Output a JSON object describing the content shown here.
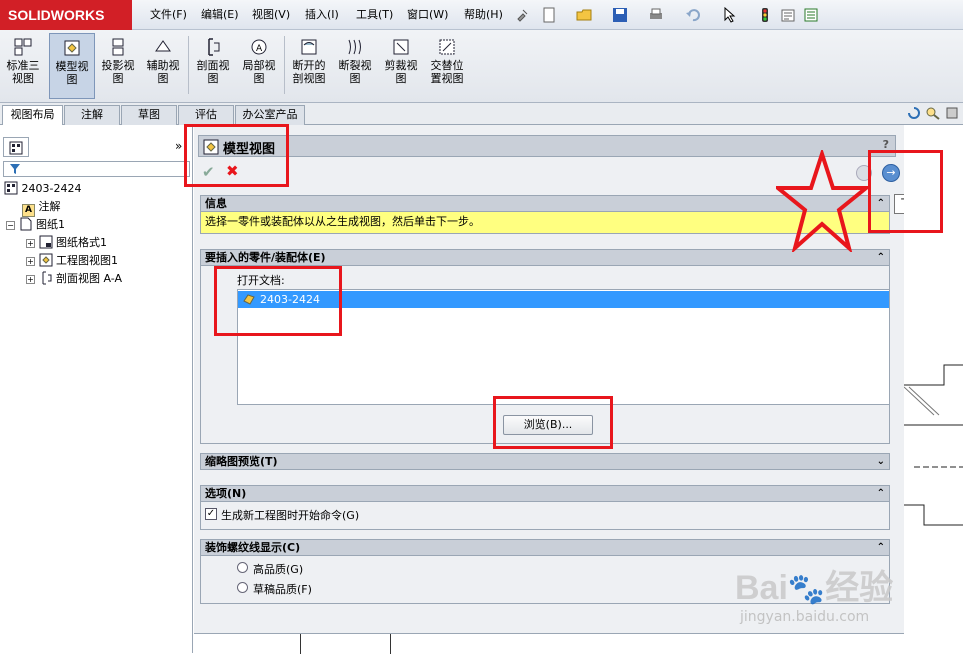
{
  "app": {
    "logo": "SOLIDWORKS"
  },
  "menu": [
    "文件(F)",
    "编辑(E)",
    "视图(V)",
    "插入(I)",
    "工具(T)",
    "窗口(W)",
    "帮助(H)"
  ],
  "ribbon": {
    "buttons": [
      {
        "label1": "标准三",
        "label2": "视图"
      },
      {
        "label1": "模型视",
        "label2": "图"
      },
      {
        "label1": "投影视",
        "label2": "图"
      },
      {
        "label1": "辅助视",
        "label2": "图"
      },
      {
        "label1": "剖面视",
        "label2": "图"
      },
      {
        "label1": "局部视",
        "label2": "图"
      },
      {
        "label1": "断开的",
        "label2": "剖视图"
      },
      {
        "label1": "断裂视",
        "label2": "图"
      },
      {
        "label1": "剪裁视",
        "label2": "图"
      },
      {
        "label1": "交替位",
        "label2": "置视图"
      }
    ]
  },
  "tabs": [
    "视图布局",
    "注解",
    "草图",
    "评估",
    "办公室产品"
  ],
  "tree": {
    "root": "2403-2424",
    "items": [
      "注解",
      "图纸1",
      "图纸格式1",
      "工程图视图1",
      "剖面视图 A-A"
    ]
  },
  "pm": {
    "title": "模型视图",
    "help": "?",
    "next_tooltip": "下一步",
    "info": {
      "header": "信息",
      "text": "选择一零件或装配体以从之生成视图，然后单击下一步。"
    },
    "insert": {
      "header": "要插入的零件/装配体(E)",
      "open_docs_label": "打开文档:",
      "doc": "2403-2424",
      "browse": "浏览(B)..."
    },
    "thumb": {
      "header": "缩略图预览(T)"
    },
    "options": {
      "header": "选项(N)",
      "checkbox": "生成新工程图时开始命令(G)"
    },
    "thread": {
      "header": "装饰螺纹线显示(C)",
      "high": "高品质(G)",
      "draft": "草稿品质(F)"
    }
  },
  "watermark": {
    "brand": "Bai",
    "brand2": "经验",
    "url": "jingyan.baidu.com"
  },
  "colors": {
    "accent": "#e8161c",
    "selection": "#3399ff",
    "info_bg": "#ffff80"
  }
}
